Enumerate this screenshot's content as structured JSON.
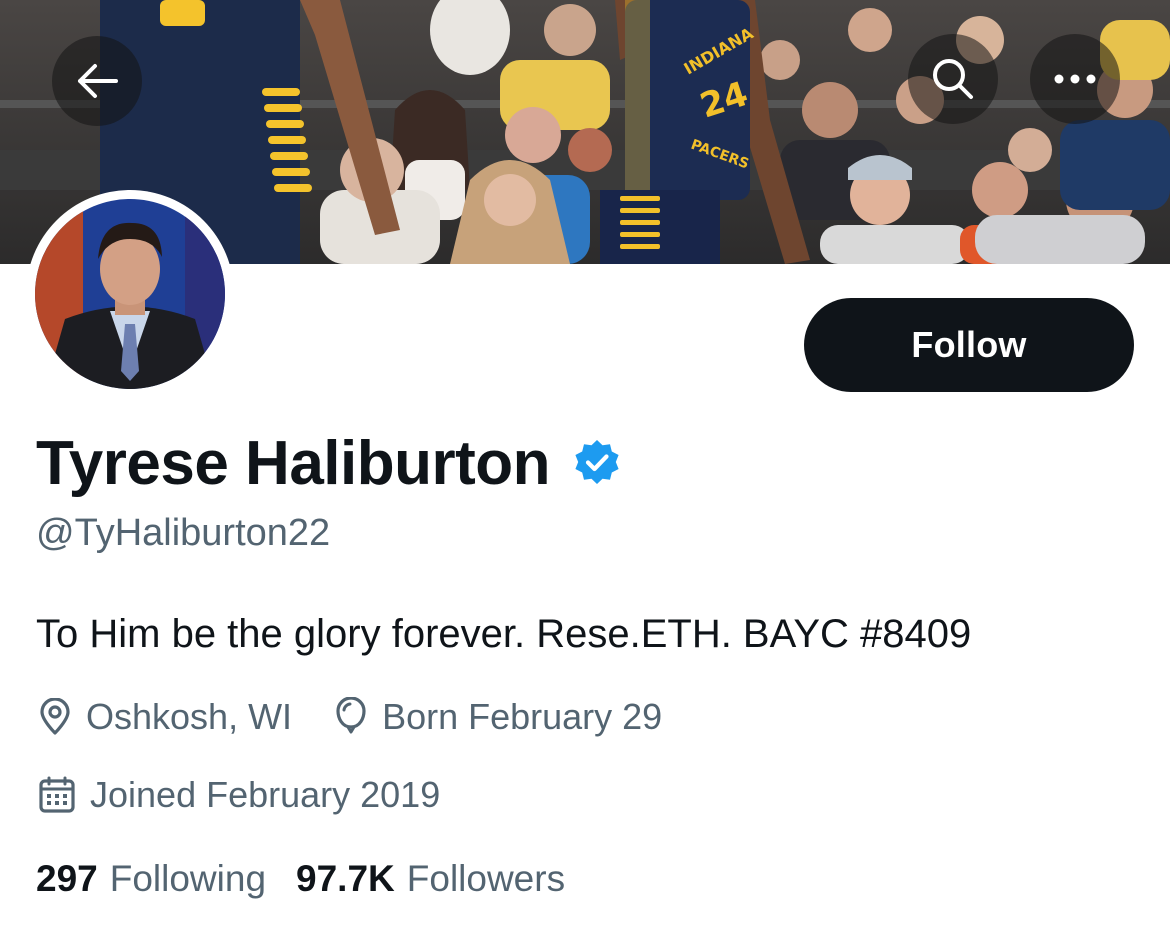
{
  "header": {
    "back_icon": "arrow-left-icon",
    "search_icon": "search-icon",
    "more_icon": "more-horizontal-icon"
  },
  "profile": {
    "display_name": "Tyrese Haliburton",
    "handle": "@TyHaliburton22",
    "verified": true,
    "verified_color": "#1d9bf0",
    "bio": "To Him be the glory forever. Rese.ETH. BAYC #8409",
    "location": "Oshkosh, WI",
    "birthday": "Born February 29",
    "joined": "Joined February 2019",
    "following_count": "297",
    "following_label": "Following",
    "followers_count": "97.7K",
    "followers_label": "Followers"
  },
  "actions": {
    "follow_label": "Follow"
  },
  "banner": {
    "jersey_text": "INDIANA PACERS",
    "jersey_number": "24"
  }
}
